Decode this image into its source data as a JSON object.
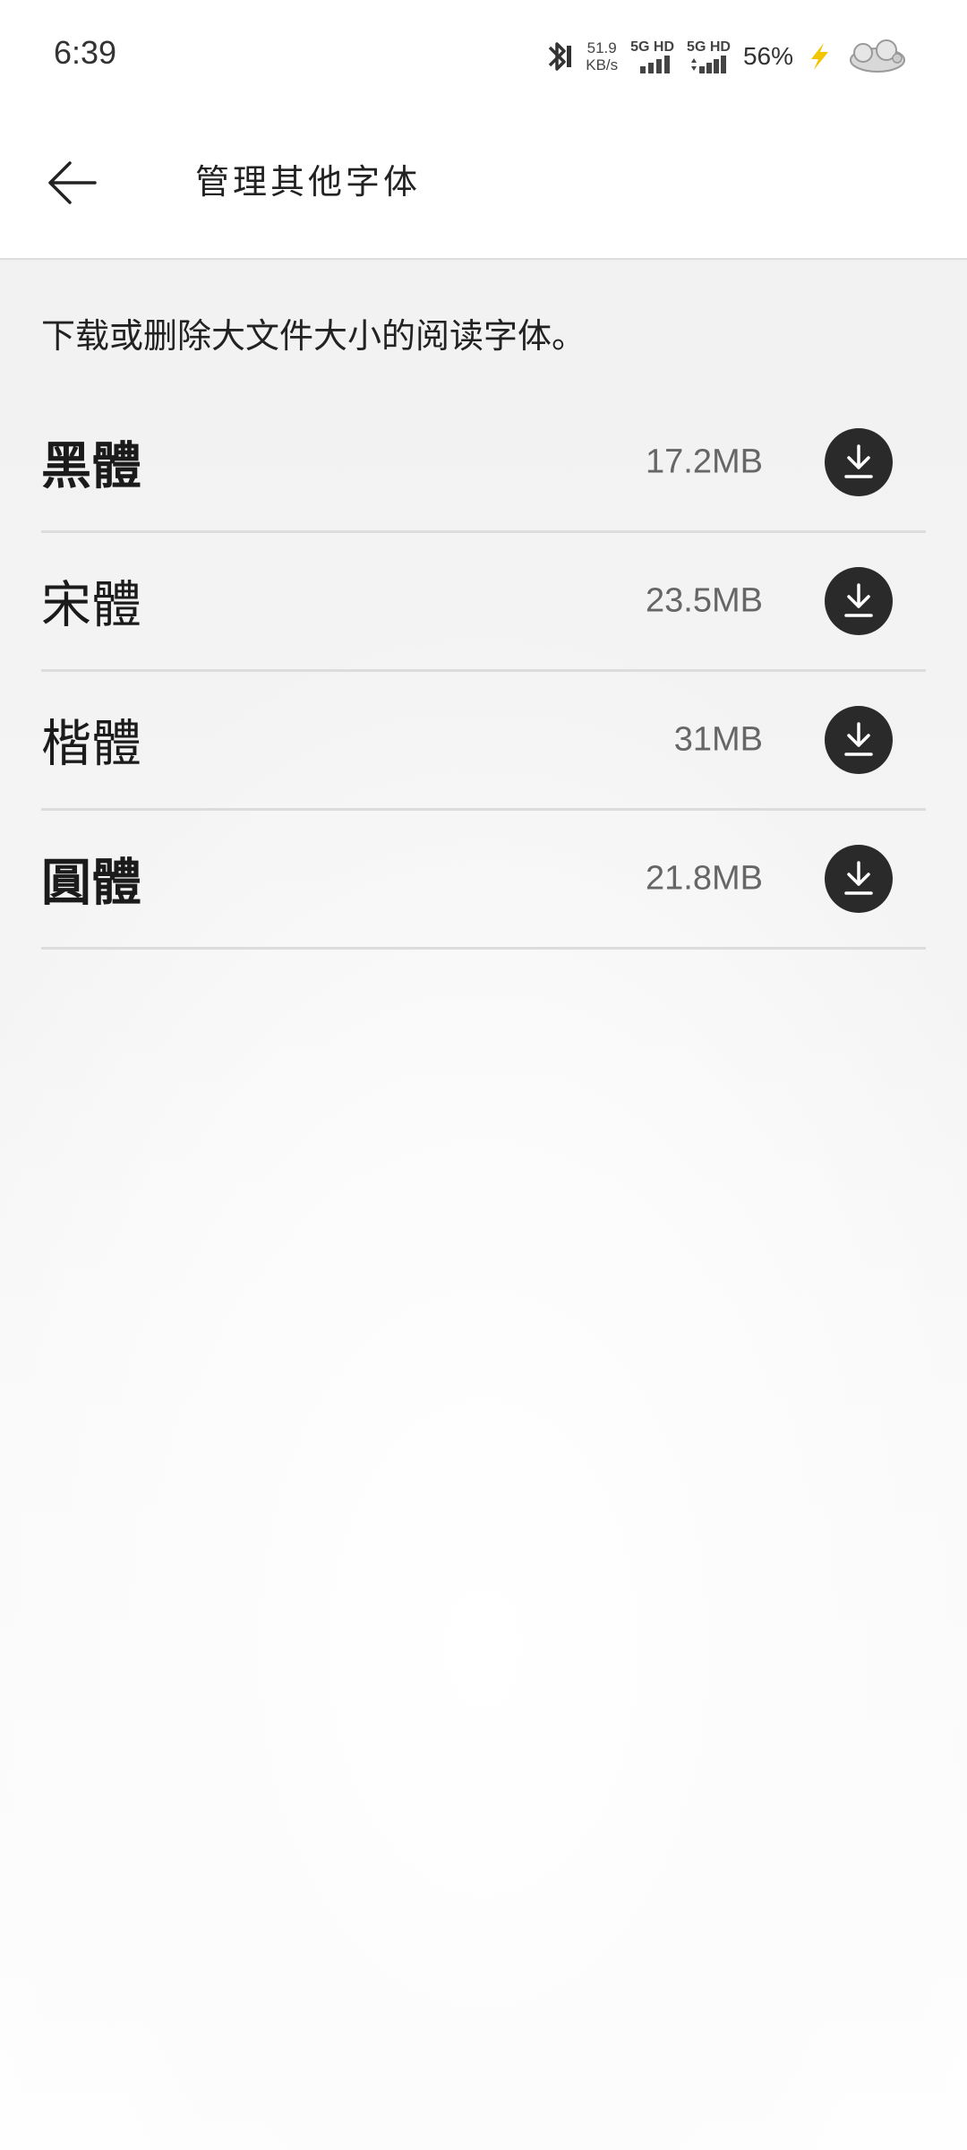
{
  "status_bar": {
    "time": "6:39",
    "net_speed_value": "51.9",
    "net_speed_unit": "KB/s",
    "sim1_label": "5G HD",
    "sim2_label": "5G HD",
    "battery_percent": "56%",
    "icons": [
      "bluetooth-icon",
      "signal-icon",
      "signal-icon",
      "charging-bolt-icon",
      "pet-icon"
    ]
  },
  "header": {
    "back_icon": "back-arrow-icon",
    "title": "管理其他字体"
  },
  "main": {
    "description": "下载或删除大文件大小的阅读字体。",
    "fonts": [
      {
        "name": "黑體",
        "size": "17.2MB",
        "action_icon": "download-icon"
      },
      {
        "name": "宋體",
        "size": "23.5MB",
        "action_icon": "download-icon"
      },
      {
        "name": "楷體",
        "size": "31MB",
        "action_icon": "download-icon"
      },
      {
        "name": "圓體",
        "size": "21.8MB",
        "action_icon": "download-icon"
      }
    ]
  },
  "colors": {
    "download_button": "#2a2a2a",
    "size_text": "#666666",
    "divider": "#dcdcdc",
    "charging_bolt": "#f2c500"
  }
}
